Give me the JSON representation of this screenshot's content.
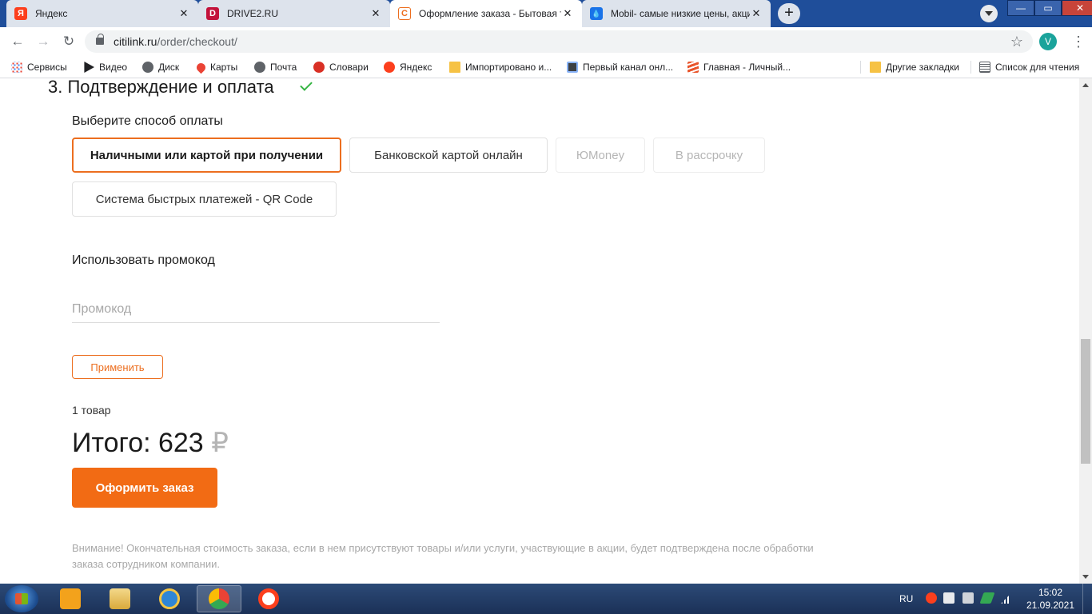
{
  "browser": {
    "tabs": [
      {
        "title": "Яндекс",
        "icon": "yandex-icon",
        "color": "#fc3f1d",
        "glyph": "Я"
      },
      {
        "title": "DRIVE2.RU",
        "icon": "drive2-icon",
        "color": "#c3123b",
        "glyph": "D"
      },
      {
        "title": "Оформление заказа - Бытовая техника",
        "icon": "citilink-icon",
        "color": "#ec6e1f",
        "glyph": "С"
      },
      {
        "title": "Mobil- самые низкие цены, акции",
        "icon": "mobil-icon",
        "color": "#1a73e8",
        "glyph": "💧"
      }
    ],
    "close_glyph": "✕",
    "new_tab_glyph": "+",
    "window_buttons": {
      "minimize": "—",
      "maximize": "▭",
      "close": "✕"
    },
    "url_host": "citilink.ru",
    "url_path": "/order/checkout/",
    "avatar_letter": "V",
    "bookmarks": [
      {
        "label": "Сервисы",
        "icon": "apps-grid-icon",
        "color": "#ea4335"
      },
      {
        "label": "Видео",
        "icon": "video-play-icon",
        "color": "#202124"
      },
      {
        "label": "Диск",
        "icon": "globe-icon",
        "color": "#5f6368"
      },
      {
        "label": "Карты",
        "icon": "map-pin-icon",
        "color": "#ea4335"
      },
      {
        "label": "Почта",
        "icon": "globe-icon",
        "color": "#5f6368"
      },
      {
        "label": "Словари",
        "icon": "dictionary-icon",
        "color": "#d93025"
      },
      {
        "label": "Яндекс",
        "icon": "yandex-icon",
        "color": "#fc3f1d"
      },
      {
        "label": "Импортировано и...",
        "icon": "folder-icon",
        "color": "#f6c244"
      },
      {
        "label": "Первый канал онл...",
        "icon": "tv-icon",
        "color": "#3c4043"
      },
      {
        "label": "Главная - Личный...",
        "icon": "stripes-icon",
        "color": "#e8542b"
      },
      {
        "label": "Другие закладки",
        "icon": "folder-icon",
        "color": "#f6c244"
      },
      {
        "label": "Список для чтения",
        "icon": "reading-list-icon",
        "color": "#5f6368"
      }
    ]
  },
  "checkout": {
    "section_title": "3. Подтверждение и оплата",
    "subtitle": "Выберите способ оплаты",
    "payment_methods": [
      {
        "label": "Наличными или картой при получении",
        "state": "selected"
      },
      {
        "label": "Банковской картой онлайн",
        "state": "normal"
      },
      {
        "label": "ЮMoney",
        "state": "disabled"
      },
      {
        "label": "В рассрочку",
        "state": "disabled"
      },
      {
        "label": "Система быстрых платежей - QR Code",
        "state": "normal"
      }
    ],
    "promo_title": "Использовать промокод",
    "promo_placeholder": "Промокод",
    "promo_value": "",
    "apply_label": "Применить",
    "item_count": "1 товар",
    "total_label": "Итого: 623",
    "currency": "₽",
    "order_button": "Оформить заказ",
    "notice": "Внимание! Окончательная стоимость заказа, если в нем присутствуют товары и/или услуги, участвующие в акции, будет подтверждена после обработки заказа сотрудником компании.",
    "accent_color": "#ec6e1f"
  },
  "taskbar": {
    "apps": [
      {
        "name": "media-player-icon",
        "color": "#f3a21c"
      },
      {
        "name": "explorer-icon",
        "color": "#e9c25c"
      },
      {
        "name": "internet-explorer-icon",
        "color": "#2f86d6"
      },
      {
        "name": "chrome-icon",
        "color": "#34a853"
      },
      {
        "name": "yandex-browser-icon",
        "color": "#fc3f1d"
      }
    ],
    "language": "RU",
    "time": "15:02",
    "date": "21.09.2021"
  }
}
